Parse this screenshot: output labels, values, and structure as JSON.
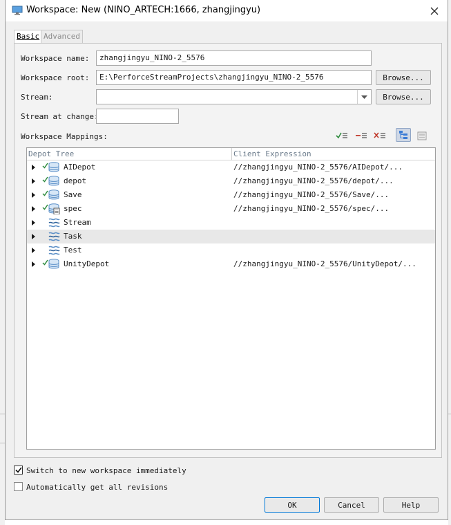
{
  "window": {
    "title": "Workspace: New (NINO_ARTECH:1666,  zhangjingyu)",
    "app_icon": "monitor-icon",
    "close_icon": "close-icon"
  },
  "tabs": [
    {
      "label": "Basic",
      "active": true
    },
    {
      "label": "Advanced",
      "active": false
    }
  ],
  "form": {
    "workspace_name_label": "Workspace name:",
    "workspace_name_value": "zhangjingyu_NINO-2_5576",
    "workspace_root_label": "Workspace root:",
    "workspace_root_value": "E:\\PerforceStreamProjects\\zhangjingyu_NINO-2_5576",
    "browse_label": "Browse...",
    "stream_label": "Stream:",
    "stream_value": "",
    "stream_browse_label": "Browse...",
    "stream_at_change_label": "Stream at change:",
    "stream_at_change_value": ""
  },
  "mappings": {
    "label": "Workspace Mappings:",
    "toolbar_icons": [
      "include-mapping-icon",
      "exclude-mapping-icon",
      "clear-mapping-icon",
      "tree-view-icon",
      "text-view-icon"
    ],
    "columns": [
      "Depot Tree",
      "Client Expression"
    ],
    "rows": [
      {
        "name": "AIDepot",
        "expr": "//zhangjingyu_NINO-2_5576/AIDepot/...",
        "mapped": true,
        "type": "local"
      },
      {
        "name": "depot",
        "expr": "//zhangjingyu_NINO-2_5576/depot/...",
        "mapped": true,
        "type": "local"
      },
      {
        "name": "Save",
        "expr": "//zhangjingyu_NINO-2_5576/Save/...",
        "mapped": true,
        "type": "local"
      },
      {
        "name": "spec",
        "expr": "//zhangjingyu_NINO-2_5576/spec/...",
        "mapped": true,
        "type": "spec"
      },
      {
        "name": "Stream",
        "expr": "",
        "mapped": false,
        "type": "stream"
      },
      {
        "name": "Task",
        "expr": "",
        "mapped": false,
        "type": "stream"
      },
      {
        "name": "Test",
        "expr": "",
        "mapped": false,
        "type": "stream"
      },
      {
        "name": "UnityDepot",
        "expr": "//zhangjingyu_NINO-2_5576/UnityDepot/...",
        "mapped": true,
        "type": "local"
      }
    ]
  },
  "options": {
    "switch_label": "Switch to new workspace immediately",
    "switch_checked": true,
    "auto_get_label": "Automatically get all revisions",
    "auto_get_checked": false
  },
  "buttons": {
    "ok": "OK",
    "cancel": "Cancel",
    "help": "Help"
  },
  "colors": {
    "accent": "#0078d7",
    "check_green": "#2e8b3e",
    "depot_blue": "#5b8fc7",
    "exclude_red": "#c0392b"
  }
}
